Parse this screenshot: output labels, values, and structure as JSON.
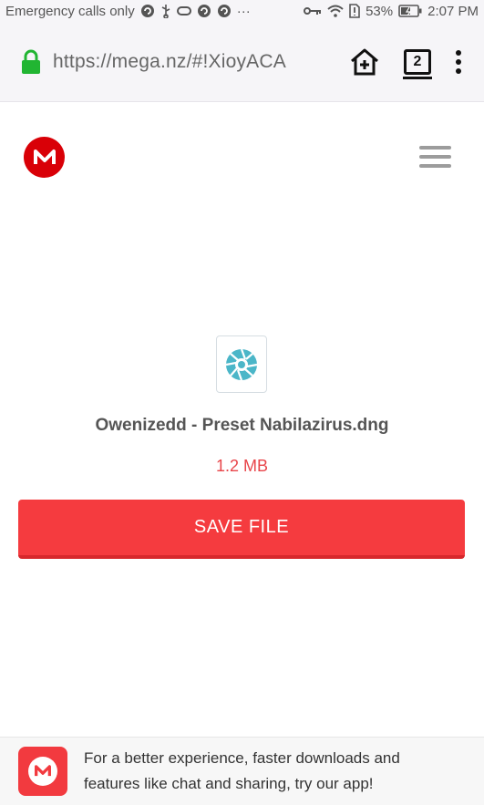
{
  "status_bar": {
    "carrier_text": "Emergency calls only",
    "more_indicator": "···",
    "battery_percent": "53%",
    "time": "2:07 PM"
  },
  "browser": {
    "url": "https://mega.nz/#!XioyACA",
    "tab_count": "2",
    "secure_color": "#21b532"
  },
  "header": {
    "logo_letter": "M",
    "brand_color": "#d90007"
  },
  "file": {
    "name": "Owenizedd - Preset Nabilazirus.dng",
    "size": "1.2 MB",
    "icon": "camera-aperture-icon"
  },
  "actions": {
    "save_label": "SAVE FILE",
    "accent_color": "#f53b3f"
  },
  "app_banner": {
    "line1": "For a better experience, faster downloads and",
    "line2": "features like chat and sharing, try our app!",
    "icon_letter": "M"
  }
}
